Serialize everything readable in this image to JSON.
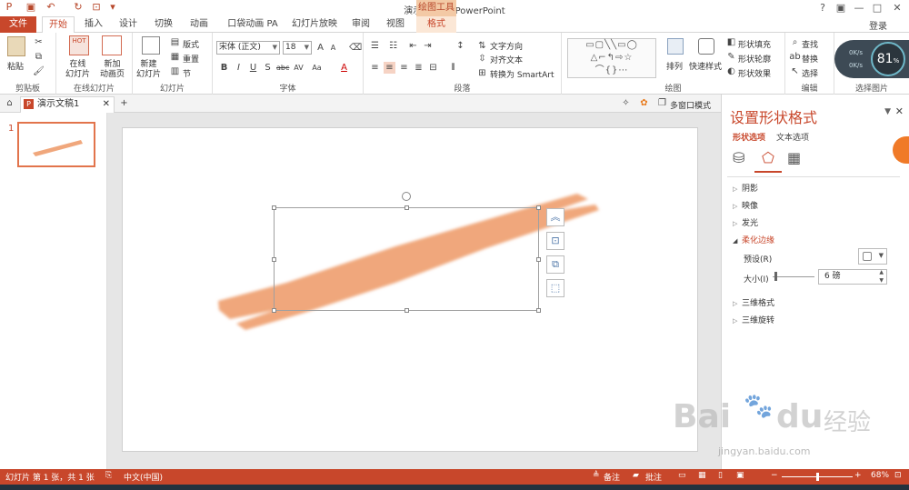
{
  "titlebar": {
    "title": "演示文稿1 - PowerPoint",
    "context_tool": "绘图工具",
    "help": "?",
    "restore": "▣",
    "minimize": "—",
    "maximize": "□",
    "close": "✕"
  },
  "tabs": [
    "文件",
    "开始",
    "插入",
    "设计",
    "切换",
    "动画",
    "口袋动画 PA",
    "幻灯片放映",
    "审阅",
    "视图",
    "格式"
  ],
  "login": "登录",
  "ribbon": {
    "clipboard": {
      "paste": "粘贴",
      "label": "剪贴板"
    },
    "online": {
      "online_slides": "在线\n幻灯片",
      "new_anim": "新加\n动画页",
      "label": "在线幻灯片",
      "hot": "HOT"
    },
    "slides": {
      "new_slide": "新建\n幻灯片",
      "layout": "版式",
      "reset": "重置",
      "section": "节",
      "label": "幻灯片"
    },
    "font": {
      "font_name": "宋体 (正文)",
      "font_size": "18",
      "label": "字体"
    },
    "paragraph": {
      "text_dir": "文字方向",
      "align_text": "对齐文本",
      "smartart": "转换为 SmartArt",
      "label": "段落"
    },
    "drawing": {
      "arrange": "排列",
      "quick_styles": "快速样式",
      "fill": "形状填充",
      "outline": "形状轮廓",
      "effects": "形状效果",
      "label": "绘图"
    },
    "editing": {
      "find": "查找",
      "replace": "替换",
      "select": "选择",
      "label": "编辑"
    },
    "select_pic": {
      "label": "选择图片"
    }
  },
  "speed": {
    "percent": "81",
    "percent_sign": "%",
    "up": "0K/s",
    "down": "0K/s"
  },
  "doc_tab": {
    "name": "演示文稿1",
    "close": "✕",
    "add": "+"
  },
  "multiwin": "多窗口模式",
  "slide_number": "1",
  "pane": {
    "title": "设置形状格式",
    "tab_shape": "形状选项",
    "tab_text": "文本选项",
    "sections": [
      "阴影",
      "映像",
      "发光",
      "柔化边缘",
      "三维格式",
      "三维旋转"
    ],
    "preset_label": "预设(R)",
    "size_label": "大小(I)",
    "size_value": "6 磅"
  },
  "status": {
    "slide_info": "幻灯片 第 1 张，共 1 张",
    "language": "中文(中国)",
    "notes": "备注",
    "comments": "批注",
    "zoom": "68%"
  },
  "watermark": {
    "brand": "Bai",
    "brand2": "du",
    "cn": "经验",
    "url": "jingyan.baidu.com"
  },
  "colors": {
    "accent": "#c8472b",
    "brush": "#f0a77c"
  }
}
